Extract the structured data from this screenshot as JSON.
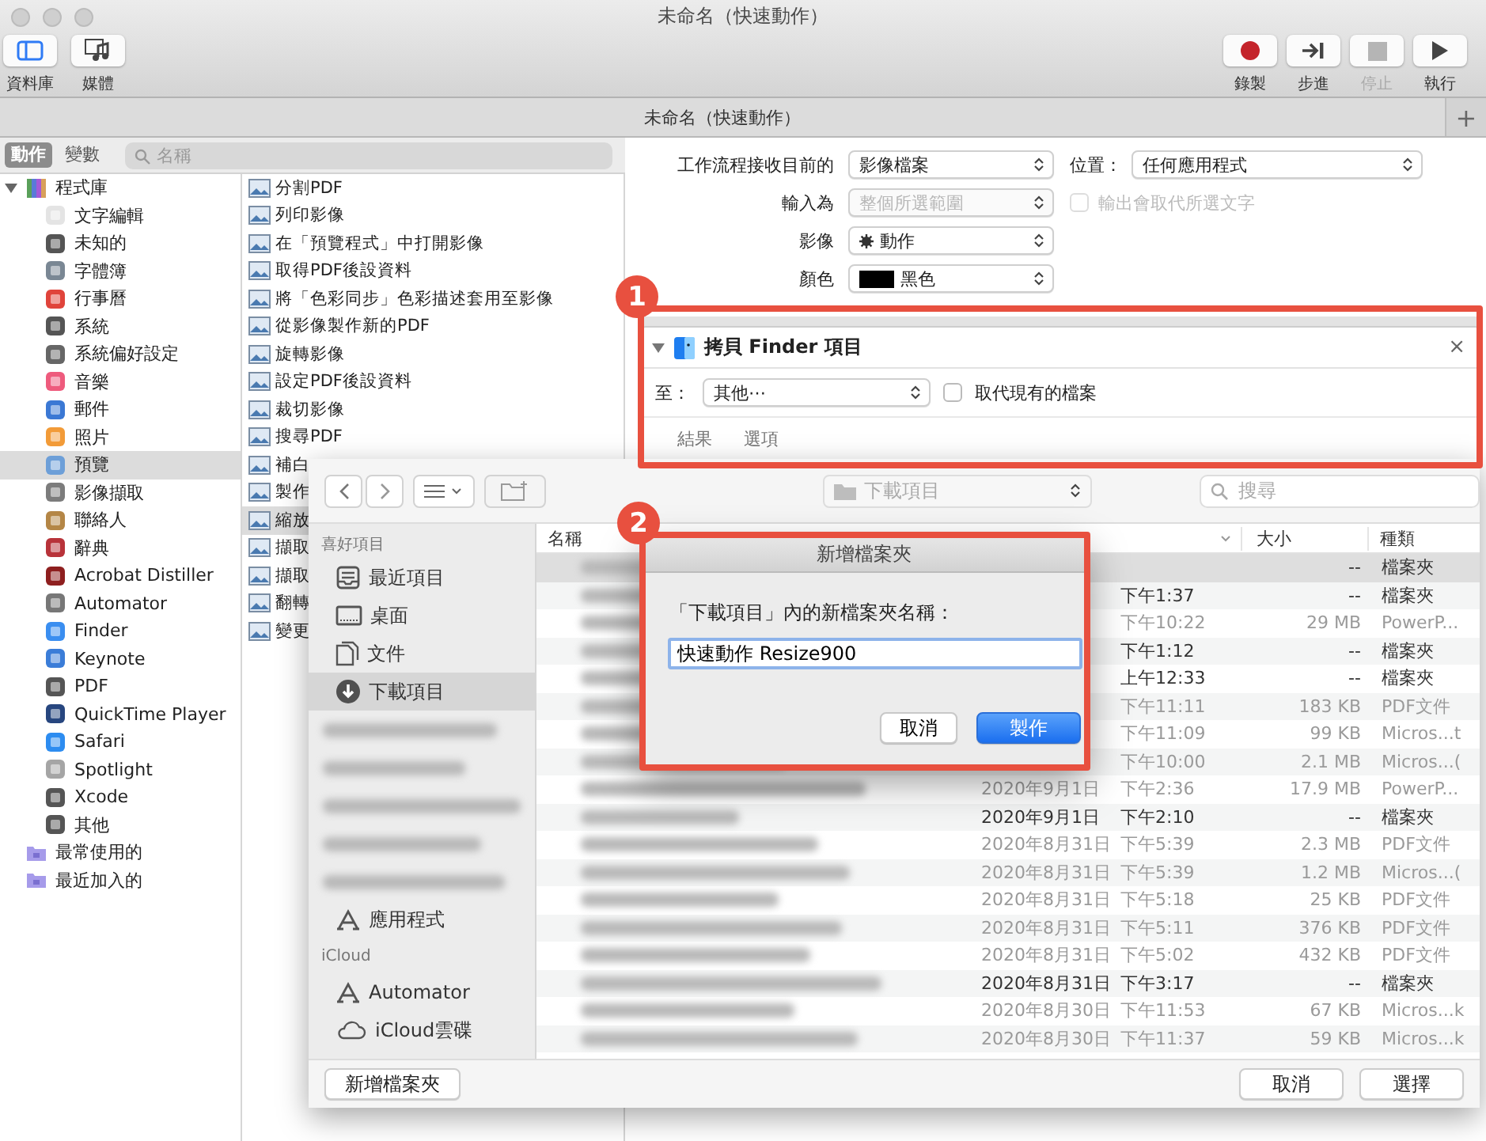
{
  "window": {
    "title": "未命名（快速動作）"
  },
  "toolbar": {
    "left": [
      {
        "label": "資料庫",
        "kind": "library",
        "selected": true
      },
      {
        "label": "媒體",
        "kind": "media",
        "selected": false
      }
    ],
    "right": [
      {
        "label": "錄製",
        "kind": "record",
        "disabled": false
      },
      {
        "label": "步進",
        "kind": "step",
        "disabled": false
      },
      {
        "label": "停止",
        "kind": "stop",
        "disabled": true
      },
      {
        "label": "執行",
        "kind": "run",
        "disabled": false
      }
    ]
  },
  "document_tab": {
    "title": "未命名（快速動作）",
    "add_button": "+"
  },
  "library": {
    "tabs": [
      {
        "label": "動作",
        "selected": true
      },
      {
        "label": "變數",
        "selected": false
      }
    ],
    "search": {
      "placeholder": "名稱"
    },
    "tree": [
      {
        "label": "程式庫",
        "expanded": true,
        "selected": false,
        "children": [
          {
            "label": "文字編輯",
            "selected": false
          },
          {
            "label": "未知的",
            "selected": false
          },
          {
            "label": "字體簿",
            "selected": false
          },
          {
            "label": "行事曆",
            "selected": false
          },
          {
            "label": "系統",
            "selected": false
          },
          {
            "label": "系統偏好設定",
            "selected": false
          },
          {
            "label": "音樂",
            "selected": false
          },
          {
            "label": "郵件",
            "selected": false
          },
          {
            "label": "照片",
            "selected": false
          },
          {
            "label": "預覽",
            "selected": true
          },
          {
            "label": "影像擷取",
            "selected": false
          },
          {
            "label": "聯絡人",
            "selected": false
          },
          {
            "label": "辭典",
            "selected": false
          },
          {
            "label": "Acrobat Distiller",
            "selected": false
          },
          {
            "label": "Automator",
            "selected": false
          },
          {
            "label": "Finder",
            "selected": false
          },
          {
            "label": "Keynote",
            "selected": false
          },
          {
            "label": "PDF",
            "selected": false
          },
          {
            "label": "QuickTime Player",
            "selected": false
          },
          {
            "label": "Safari",
            "selected": false
          },
          {
            "label": "Spotlight",
            "selected": false
          },
          {
            "label": "Xcode",
            "selected": false
          },
          {
            "label": "其他",
            "selected": false
          }
        ]
      },
      {
        "label": "最常使用的",
        "selected": false
      },
      {
        "label": "最近加入的",
        "selected": false
      }
    ],
    "actions": [
      {
        "label": "分割PDF",
        "selected": false
      },
      {
        "label": "列印影像",
        "selected": false
      },
      {
        "label": "在「預覽程式」中打開影像",
        "selected": false
      },
      {
        "label": "取得PDF後設資料",
        "selected": false
      },
      {
        "label": "將「色彩同步」色彩描述套用至影像",
        "selected": false
      },
      {
        "label": "從影像製作新的PDF",
        "selected": false
      },
      {
        "label": "旋轉影像",
        "selected": false
      },
      {
        "label": "設定PDF後設資料",
        "selected": false
      },
      {
        "label": "裁切影像",
        "selected": false
      },
      {
        "label": "搜尋PDF",
        "selected": false
      },
      {
        "label": "補白",
        "selected": false
      },
      {
        "label": "製作",
        "selected": false
      },
      {
        "label": "縮放",
        "selected": true
      },
      {
        "label": "擷取",
        "selected": false
      },
      {
        "label": "擷取",
        "selected": false
      },
      {
        "label": "翻轉",
        "selected": false
      },
      {
        "label": "變更",
        "selected": false
      }
    ]
  },
  "workflow": {
    "rows": [
      {
        "label": "工作流程接收目前的",
        "popup": {
          "kind": "text",
          "value": "影像檔案",
          "disabled": false
        },
        "side": {
          "kind": "popup",
          "label": "位置：",
          "value": "任何應用程式"
        }
      },
      {
        "label": "輸入為",
        "popup": {
          "kind": "text",
          "value": "整個所選範圍",
          "disabled": true
        },
        "side": {
          "kind": "checkbox",
          "label": "輸出會取代所選文字",
          "checked": false,
          "disabled": true
        }
      },
      {
        "label": "影像",
        "popup": {
          "kind": "action",
          "value": "動作",
          "disabled": false
        }
      },
      {
        "label": "顏色",
        "popup": {
          "kind": "color",
          "value": "黑色",
          "color": "#000000",
          "disabled": false
        }
      }
    ]
  },
  "action_card": {
    "callout": "1",
    "title": "拷貝 Finder 項目",
    "expanded": true,
    "close": "×",
    "to_label": "至：",
    "to_value": "其他⋯",
    "replace": {
      "label": "取代現有的檔案",
      "checked": false
    },
    "footer_tabs": [
      {
        "label": "結果",
        "selected": false
      },
      {
        "label": "選項",
        "selected": false
      }
    ]
  },
  "file_sheet": {
    "location": "下載項目",
    "search_placeholder": "搜尋",
    "sidebar": [
      {
        "title": "喜好項目",
        "items": [
          {
            "kind": "recents",
            "label": "最近項目",
            "selected": false
          },
          {
            "kind": "desktop",
            "label": "桌面",
            "selected": false
          },
          {
            "kind": "documents",
            "label": "文件",
            "selected": false
          },
          {
            "kind": "downloads",
            "label": "下載項目",
            "selected": true
          },
          {
            "kind": "blurred",
            "selected": false
          },
          {
            "kind": "blurred",
            "selected": false
          },
          {
            "kind": "blurred",
            "selected": false
          },
          {
            "kind": "blurred",
            "selected": false
          },
          {
            "kind": "blurred",
            "selected": false
          },
          {
            "kind": "applications",
            "label": "應用程式",
            "selected": false
          }
        ]
      },
      {
        "title": "iCloud",
        "items": [
          {
            "kind": "applications",
            "label": "Automator",
            "selected": false
          },
          {
            "kind": "cloud",
            "label": "iCloud雲碟",
            "selected": false
          }
        ]
      }
    ],
    "columns": {
      "name": "名稱",
      "size": "大小",
      "type": "種類"
    },
    "rows": [
      {
        "size": "--",
        "type": "檔案夾",
        "folder": true,
        "selected": true
      },
      {
        "time": "下午1:37",
        "size": "--",
        "type": "檔案夾",
        "folder": true,
        "selected": false
      },
      {
        "time": "下午10:22",
        "size": "29 MB",
        "type": "PowerP...",
        "folder": false,
        "selected": false
      },
      {
        "time": "下午1:12",
        "size": "--",
        "type": "檔案夾",
        "folder": true,
        "selected": false
      },
      {
        "time": "上午12:33",
        "size": "--",
        "type": "檔案夾",
        "folder": true,
        "selected": false
      },
      {
        "time": "下午11:11",
        "size": "183 KB",
        "type": "PDF文件",
        "folder": false,
        "selected": false
      },
      {
        "time": "下午11:09",
        "size": "99 KB",
        "type": "Micros...t",
        "folder": false,
        "selected": false
      },
      {
        "time": "下午10:00",
        "size": "2.1 MB",
        "type": "Micros...(",
        "folder": false,
        "selected": false
      },
      {
        "day": "2020年9月1日",
        "time": "下午2:36",
        "size": "17.9 MB",
        "type": "PowerP...",
        "folder": false,
        "selected": false
      },
      {
        "day": "2020年9月1日",
        "time": "下午2:10",
        "size": "--",
        "type": "檔案夾",
        "folder": true,
        "selected": false
      },
      {
        "day": "2020年8月31日",
        "time": "下午5:39",
        "size": "2.3 MB",
        "type": "PDF文件",
        "folder": false,
        "selected": false
      },
      {
        "day": "2020年8月31日",
        "time": "下午5:39",
        "size": "1.2 MB",
        "type": "Micros...(",
        "folder": false,
        "selected": false
      },
      {
        "day": "2020年8月31日",
        "time": "下午5:18",
        "size": "25 KB",
        "type": "PDF文件",
        "folder": false,
        "selected": false
      },
      {
        "day": "2020年8月31日",
        "time": "下午5:11",
        "size": "376 KB",
        "type": "PDF文件",
        "folder": false,
        "selected": false
      },
      {
        "day": "2020年8月31日",
        "time": "下午5:02",
        "size": "432 KB",
        "type": "PDF文件",
        "folder": false,
        "selected": false
      },
      {
        "day": "2020年8月31日",
        "time": "下午3:17",
        "size": "--",
        "type": "檔案夾",
        "folder": true,
        "selected": false
      },
      {
        "day": "2020年8月30日",
        "time": "下午11:53",
        "size": "67 KB",
        "type": "Micros...k",
        "folder": false,
        "selected": false
      },
      {
        "day": "2020年8月30日",
        "time": "下午11:37",
        "size": "59 KB",
        "type": "Micros...k",
        "folder": false,
        "selected": false
      }
    ],
    "buttons": [
      {
        "kind": "new_folder",
        "label": "新增檔案夾"
      },
      {
        "kind": "cancel",
        "label": "取消"
      },
      {
        "kind": "choose",
        "label": "選擇"
      }
    ]
  },
  "folder_dialog": {
    "callout": "2",
    "title": "新增檔案夾",
    "prompt": "「下載項目」內的新檔案夾名稱：",
    "value": "快速動作 Resize900",
    "buttons": [
      {
        "label": "取消",
        "default": false
      },
      {
        "label": "製作",
        "default": true
      }
    ]
  }
}
